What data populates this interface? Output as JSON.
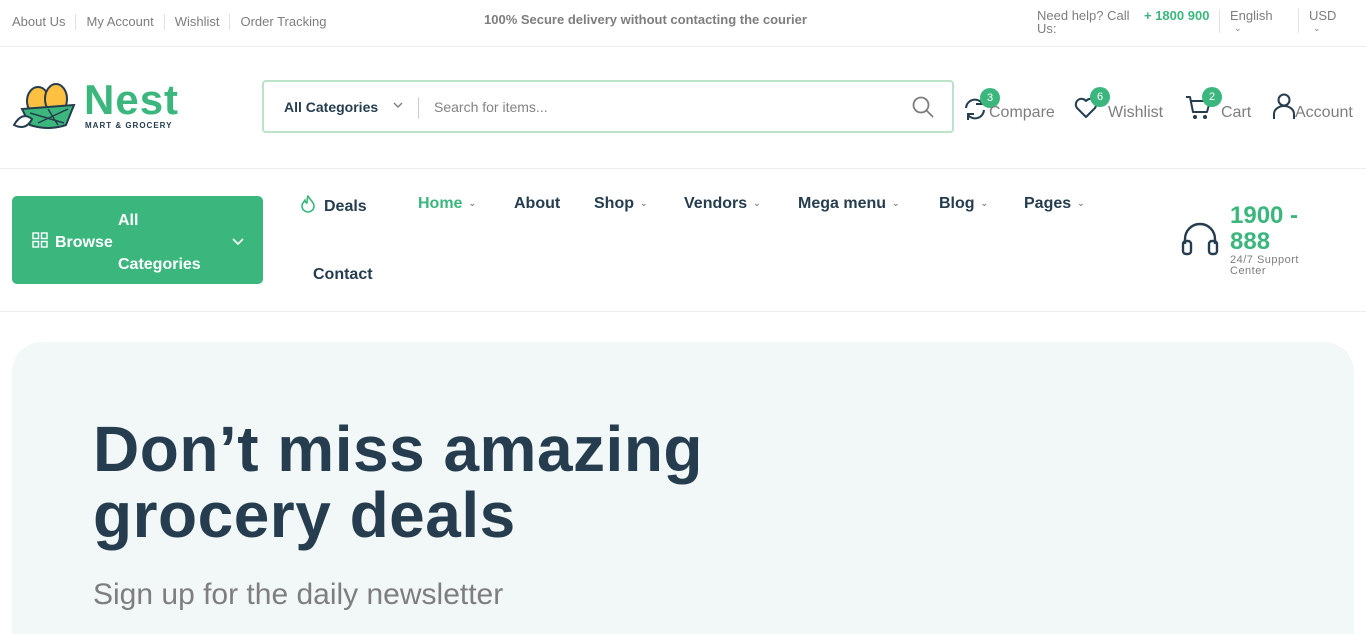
{
  "topbar": {
    "links": [
      "About Us",
      "My Account",
      "Wishlist",
      "Order Tracking"
    ],
    "promo": "100% Secure delivery without contacting the courier",
    "help_label": "Need help? Call Us:",
    "help_phone": "+ 1800 900",
    "language": "English",
    "currency": "USD"
  },
  "logo": {
    "name": "Nest",
    "tagline": "MART & GROCERY"
  },
  "search": {
    "category": "All Categories",
    "placeholder": "Search for items..."
  },
  "header_actions": {
    "compare": {
      "label": "Compare",
      "count": "3"
    },
    "wishlist": {
      "label": "Wishlist",
      "count": "6"
    },
    "cart": {
      "label": "Cart",
      "count": "2"
    },
    "account": {
      "label": "Account"
    }
  },
  "nav": {
    "browse_line1": "All",
    "browse_line2": "Browse",
    "browse_line3": "Categories",
    "deals": "Deals",
    "home": "Home",
    "about": "About",
    "shop": "Shop",
    "vendors": "Vendors",
    "mega_menu": "Mega menu",
    "blog": "Blog",
    "pages": "Pages",
    "contact": "Contact"
  },
  "support": {
    "phone": "1900 - 888",
    "label": "24/7 Support Center"
  },
  "hero": {
    "title": "Don’t miss amazing grocery deals",
    "subtitle": "Sign up for the daily newsletter"
  },
  "colors": {
    "brand": "#3bb77e",
    "heading": "#253d4e",
    "muted": "#7e7e7e",
    "hero_bg": "#f2f7f8"
  }
}
